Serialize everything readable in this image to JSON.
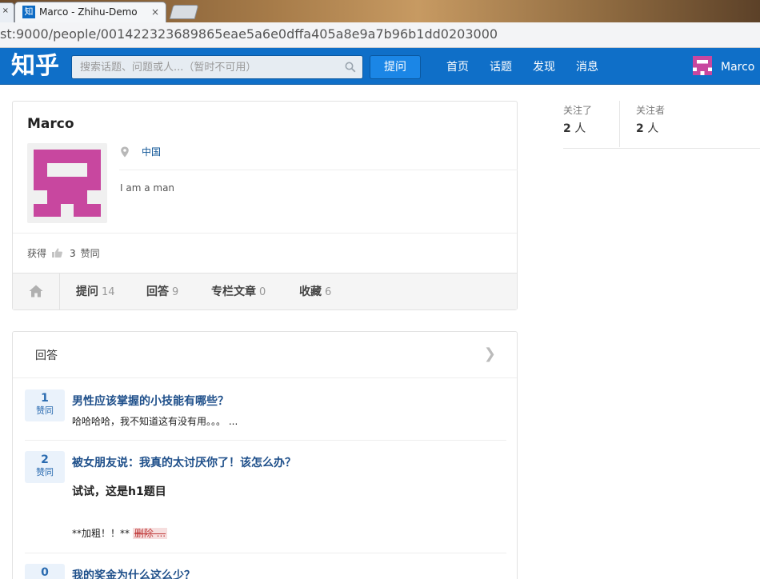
{
  "browser": {
    "prev_tab_close": "×",
    "tab_favicon": "知",
    "tab_title": "Marco - Zhihu-Demo",
    "tab_close": "×",
    "url": "st:9000/people/001422323689865eae5a6e0dffa405a8e9a7b96b1dd0203000"
  },
  "header": {
    "logo": "知乎",
    "search_placeholder": "搜索话题、问题或人...（暂时不可用）",
    "ask_label": "提问",
    "nav": [
      "首页",
      "话题",
      "发现",
      "消息"
    ],
    "user_name": "Marco",
    "brand_color": "#0f6fc8"
  },
  "profile": {
    "name": "Marco",
    "location": "中国",
    "bio": "I am a man",
    "votes_prefix": "获得",
    "votes_count": "3",
    "votes_suffix": "赞同",
    "avatar_color": "#c8479f",
    "tabs": [
      {
        "label": "提问",
        "count": "14"
      },
      {
        "label": "回答",
        "count": "9"
      },
      {
        "label": "专栏文章",
        "count": "0"
      },
      {
        "label": "收藏",
        "count": "6"
      }
    ]
  },
  "side": {
    "following_label": "关注了",
    "following_count": "2",
    "following_unit": "人",
    "followers_label": "关注者",
    "followers_count": "2",
    "followers_unit": "人"
  },
  "answers": {
    "title": "回答",
    "vote_label": "赞同",
    "items": [
      {
        "votes": "1",
        "question": "男性应该掌握的小技能有哪些？",
        "excerpt": "哈哈哈哈，我不知道这有没有用。。。 ..."
      },
      {
        "votes": "2",
        "question": "被女朋友说：我真的太讨厌你了！该怎么办？",
        "h1": "试试，这是h1题目",
        "bold_text": "**加粗！！** ",
        "strike_text": "删除 ..."
      },
      {
        "votes": "0",
        "question": "我的奖金为什么这么少？"
      }
    ]
  }
}
